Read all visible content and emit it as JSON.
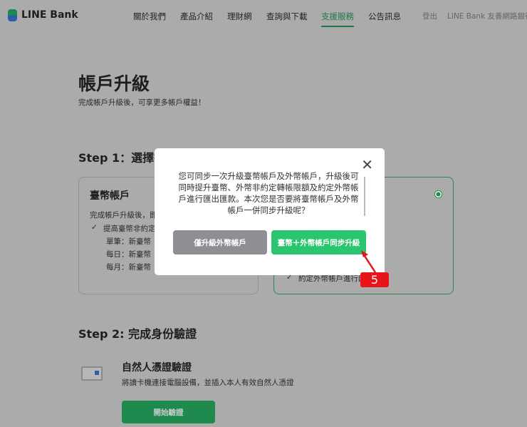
{
  "header": {
    "logo": "LINE Bank",
    "nav": [
      "關於我們",
      "產品介紹",
      "理財網",
      "查詢與下載",
      "支援服務",
      "公告訊息"
    ],
    "active": "支援服務",
    "logout": "登出",
    "friendly": "LINE Bank 友善網路銀行"
  },
  "page": {
    "title": "帳戶升級",
    "subtitle": "完成帳戶升級後，可享更多帳戶權益！",
    "step1": "Step 1：選擇欲",
    "step2": "Step 2: 完成身份驗證"
  },
  "card_twd": {
    "title": "臺幣帳戶",
    "desc": "完成帳戶升級後，即",
    "check": "提高臺幣非約定",
    "items": [
      "單筆：新臺幣",
      "每日：新臺幣",
      "每月：新臺幣"
    ]
  },
  "card_fx": {
    "check": "約定外幣帳戶進行匯"
  },
  "verify": {
    "title": "自然人憑證驗證",
    "desc": "將讀卡機連接電腦設備，並插入本人有效自然人憑證",
    "button": "開始驗證"
  },
  "modal": {
    "message": "您可同步一次升級臺幣帳戶及外幣帳戶，升級後可同時提升臺幣、外幣非約定轉帳限額及約定外幣帳戶進行匯出匯款。本次您是否要將臺幣帳戶及外幣帳戶一併同步升級呢？",
    "btn_fx_only": "僅升級外幣帳戶",
    "btn_both": "臺幣＋外幣帳戶同步升級"
  },
  "annotation": {
    "step": "5",
    "color": "#e8141b"
  },
  "colors": {
    "green": "#2bc46f",
    "accent": "#1f8a4e"
  }
}
